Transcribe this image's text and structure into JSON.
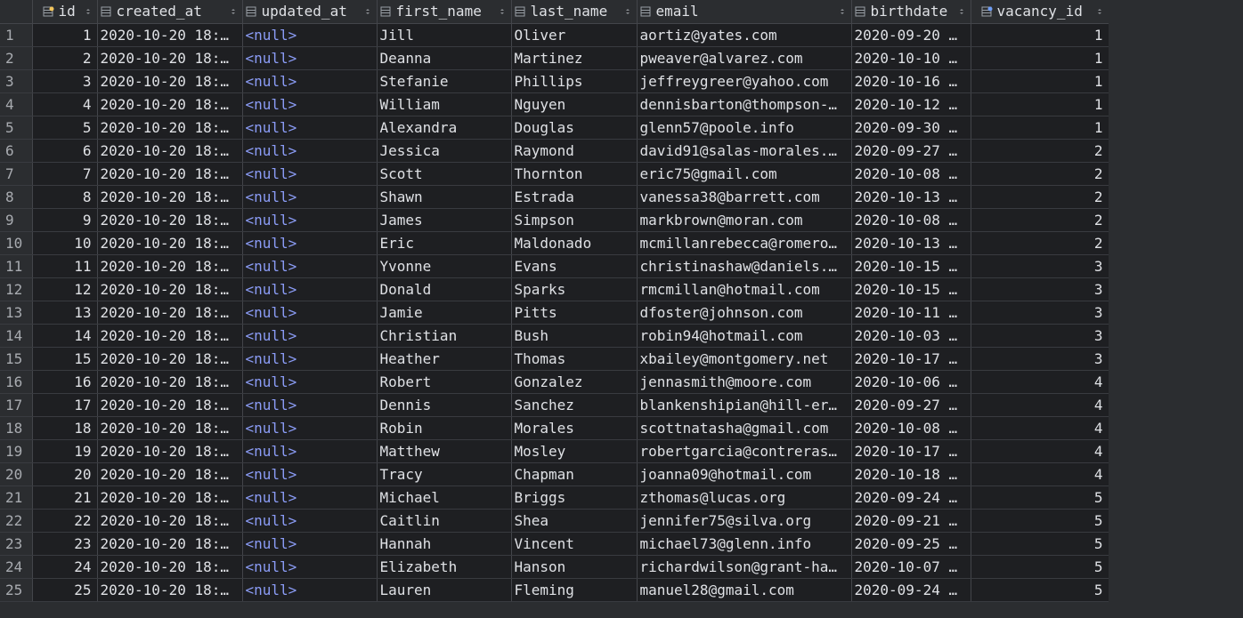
{
  "columns": [
    {
      "name": "id",
      "icon": "primary-key-column-icon",
      "align": "right"
    },
    {
      "name": "created_at",
      "icon": "column-icon",
      "align": "left"
    },
    {
      "name": "updated_at",
      "icon": "column-icon",
      "align": "left"
    },
    {
      "name": "first_name",
      "icon": "column-icon",
      "align": "left"
    },
    {
      "name": "last_name",
      "icon": "column-icon",
      "align": "left"
    },
    {
      "name": "email",
      "icon": "column-icon",
      "align": "left"
    },
    {
      "name": "birthdate",
      "icon": "column-icon",
      "align": "left"
    },
    {
      "name": "vacancy_id",
      "icon": "foreign-key-column-icon",
      "align": "right"
    }
  ],
  "rows": [
    {
      "n": "1",
      "id": "1",
      "created_at": "2020-10-20 18:…",
      "updated_at": "<null>",
      "first_name": "Jill",
      "last_name": "Oliver",
      "email": "aortiz@yates.com",
      "birthdate": "2020-09-20 …",
      "vacancy_id": "1"
    },
    {
      "n": "2",
      "id": "2",
      "created_at": "2020-10-20 18:…",
      "updated_at": "<null>",
      "first_name": "Deanna",
      "last_name": "Martinez",
      "email": "pweaver@alvarez.com",
      "birthdate": "2020-10-10 …",
      "vacancy_id": "1"
    },
    {
      "n": "3",
      "id": "3",
      "created_at": "2020-10-20 18:…",
      "updated_at": "<null>",
      "first_name": "Stefanie",
      "last_name": "Phillips",
      "email": "jeffreygreer@yahoo.com",
      "birthdate": "2020-10-16 …",
      "vacancy_id": "1"
    },
    {
      "n": "4",
      "id": "4",
      "created_at": "2020-10-20 18:…",
      "updated_at": "<null>",
      "first_name": "William",
      "last_name": "Nguyen",
      "email": "dennisbarton@thompson-…",
      "birthdate": "2020-10-12 …",
      "vacancy_id": "1"
    },
    {
      "n": "5",
      "id": "5",
      "created_at": "2020-10-20 18:…",
      "updated_at": "<null>",
      "first_name": "Alexandra",
      "last_name": "Douglas",
      "email": "glenn57@poole.info",
      "birthdate": "2020-09-30 …",
      "vacancy_id": "1"
    },
    {
      "n": "6",
      "id": "6",
      "created_at": "2020-10-20 18:…",
      "updated_at": "<null>",
      "first_name": "Jessica",
      "last_name": "Raymond",
      "email": "david91@salas-morales.…",
      "birthdate": "2020-09-27 …",
      "vacancy_id": "2"
    },
    {
      "n": "7",
      "id": "7",
      "created_at": "2020-10-20 18:…",
      "updated_at": "<null>",
      "first_name": "Scott",
      "last_name": "Thornton",
      "email": "eric75@gmail.com",
      "birthdate": "2020-10-08 …",
      "vacancy_id": "2"
    },
    {
      "n": "8",
      "id": "8",
      "created_at": "2020-10-20 18:…",
      "updated_at": "<null>",
      "first_name": "Shawn",
      "last_name": "Estrada",
      "email": "vanessa38@barrett.com",
      "birthdate": "2020-10-13 …",
      "vacancy_id": "2"
    },
    {
      "n": "9",
      "id": "9",
      "created_at": "2020-10-20 18:…",
      "updated_at": "<null>",
      "first_name": "James",
      "last_name": "Simpson",
      "email": "markbrown@moran.com",
      "birthdate": "2020-10-08 …",
      "vacancy_id": "2"
    },
    {
      "n": "10",
      "id": "10",
      "created_at": "2020-10-20 18:…",
      "updated_at": "<null>",
      "first_name": "Eric",
      "last_name": "Maldonado",
      "email": "mcmillanrebecca@romero…",
      "birthdate": "2020-10-13 …",
      "vacancy_id": "2"
    },
    {
      "n": "11",
      "id": "11",
      "created_at": "2020-10-20 18:…",
      "updated_at": "<null>",
      "first_name": "Yvonne",
      "last_name": "Evans",
      "email": "christinashaw@daniels.…",
      "birthdate": "2020-10-15 …",
      "vacancy_id": "3"
    },
    {
      "n": "12",
      "id": "12",
      "created_at": "2020-10-20 18:…",
      "updated_at": "<null>",
      "first_name": "Donald",
      "last_name": "Sparks",
      "email": "rmcmillan@hotmail.com",
      "birthdate": "2020-10-15 …",
      "vacancy_id": "3"
    },
    {
      "n": "13",
      "id": "13",
      "created_at": "2020-10-20 18:…",
      "updated_at": "<null>",
      "first_name": "Jamie",
      "last_name": "Pitts",
      "email": "dfoster@johnson.com",
      "birthdate": "2020-10-11 …",
      "vacancy_id": "3"
    },
    {
      "n": "14",
      "id": "14",
      "created_at": "2020-10-20 18:…",
      "updated_at": "<null>",
      "first_name": "Christian",
      "last_name": "Bush",
      "email": "robin94@hotmail.com",
      "birthdate": "2020-10-03 …",
      "vacancy_id": "3"
    },
    {
      "n": "15",
      "id": "15",
      "created_at": "2020-10-20 18:…",
      "updated_at": "<null>",
      "first_name": "Heather",
      "last_name": "Thomas",
      "email": "xbailey@montgomery.net",
      "birthdate": "2020-10-17 …",
      "vacancy_id": "3"
    },
    {
      "n": "16",
      "id": "16",
      "created_at": "2020-10-20 18:…",
      "updated_at": "<null>",
      "first_name": "Robert",
      "last_name": "Gonzalez",
      "email": "jennasmith@moore.com",
      "birthdate": "2020-10-06 …",
      "vacancy_id": "4"
    },
    {
      "n": "17",
      "id": "17",
      "created_at": "2020-10-20 18:…",
      "updated_at": "<null>",
      "first_name": "Dennis",
      "last_name": "Sanchez",
      "email": "blankenshipian@hill-er…",
      "birthdate": "2020-09-27 …",
      "vacancy_id": "4"
    },
    {
      "n": "18",
      "id": "18",
      "created_at": "2020-10-20 18:…",
      "updated_at": "<null>",
      "first_name": "Robin",
      "last_name": "Morales",
      "email": "scottnatasha@gmail.com",
      "birthdate": "2020-10-08 …",
      "vacancy_id": "4"
    },
    {
      "n": "19",
      "id": "19",
      "created_at": "2020-10-20 18:…",
      "updated_at": "<null>",
      "first_name": "Matthew",
      "last_name": "Mosley",
      "email": "robertgarcia@contreras…",
      "birthdate": "2020-10-17 …",
      "vacancy_id": "4"
    },
    {
      "n": "20",
      "id": "20",
      "created_at": "2020-10-20 18:…",
      "updated_at": "<null>",
      "first_name": "Tracy",
      "last_name": "Chapman",
      "email": "joanna09@hotmail.com",
      "birthdate": "2020-10-18 …",
      "vacancy_id": "4"
    },
    {
      "n": "21",
      "id": "21",
      "created_at": "2020-10-20 18:…",
      "updated_at": "<null>",
      "first_name": "Michael",
      "last_name": "Briggs",
      "email": "zthomas@lucas.org",
      "birthdate": "2020-09-24 …",
      "vacancy_id": "5"
    },
    {
      "n": "22",
      "id": "22",
      "created_at": "2020-10-20 18:…",
      "updated_at": "<null>",
      "first_name": "Caitlin",
      "last_name": "Shea",
      "email": "jennifer75@silva.org",
      "birthdate": "2020-09-21 …",
      "vacancy_id": "5"
    },
    {
      "n": "23",
      "id": "23",
      "created_at": "2020-10-20 18:…",
      "updated_at": "<null>",
      "first_name": "Hannah",
      "last_name": "Vincent",
      "email": "michael73@glenn.info",
      "birthdate": "2020-09-25 …",
      "vacancy_id": "5"
    },
    {
      "n": "24",
      "id": "24",
      "created_at": "2020-10-20 18:…",
      "updated_at": "<null>",
      "first_name": "Elizabeth",
      "last_name": "Hanson",
      "email": "richardwilson@grant-ha…",
      "birthdate": "2020-10-07 …",
      "vacancy_id": "5"
    },
    {
      "n": "25",
      "id": "25",
      "created_at": "2020-10-20 18:…",
      "updated_at": "<null>",
      "first_name": "Lauren",
      "last_name": "Fleming",
      "email": "manuel28@gmail.com",
      "birthdate": "2020-09-24 …",
      "vacancy_id": "5"
    }
  ],
  "colors": {
    "background": "#2b2d30",
    "cell_background": "#1e1f22",
    "text": "#dfe1e5",
    "null_text": "#8b9cf6",
    "grid_line": "#43454a"
  }
}
